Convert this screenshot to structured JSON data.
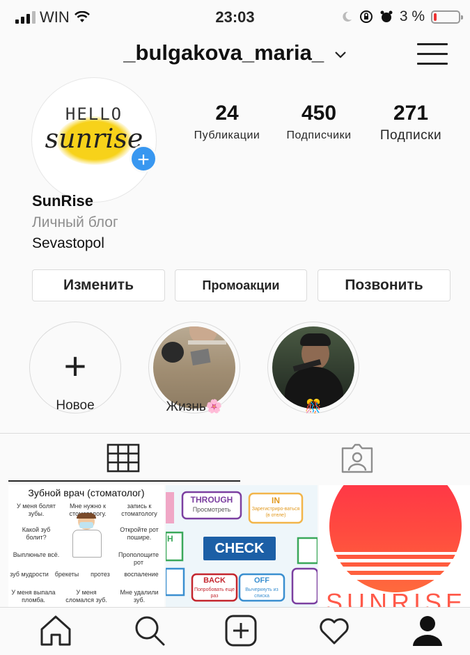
{
  "status_bar": {
    "carrier": "WIN",
    "time": "23:03",
    "battery": "3 %",
    "battery_level": 0.03
  },
  "header": {
    "username": "_bulgakova_maria_",
    "menu_icon": "hamburger-menu-icon"
  },
  "avatar": {
    "line1": "HELLO",
    "line2": "sunrise"
  },
  "stats": [
    {
      "value": "24",
      "label": "Публикации"
    },
    {
      "value": "450",
      "label": "Подписчики"
    },
    {
      "value": "271",
      "label": "Подписки"
    }
  ],
  "bio": {
    "name": "SunRise",
    "category": "Личный блог",
    "city": "Sevastopol"
  },
  "buttons": {
    "edit": "Изменить",
    "promotions": "Промоакции",
    "call": "Позвонить"
  },
  "highlights": [
    {
      "label": "Новое"
    },
    {
      "label": "Жизнь🌸"
    },
    {
      "label": "🎊"
    }
  ],
  "posts": {
    "dental": {
      "title": "Зубной врач (стоматолог)",
      "rows": [
        [
          "У меня болят зубы.",
          "Мне нужно к стоматологу.",
          "запись к стоматологу"
        ],
        [
          "Какой зуб болит?",
          "",
          "Откройте рот пошире."
        ],
        [
          "Выплюньте всё.",
          "",
          "Прополощите рот"
        ],
        [
          "зуб мудрости",
          "брекеты",
          "протез",
          "воспаление"
        ],
        [
          "У меня выпала пломба.",
          "У меня сломался зуб.",
          "Мне удалили зуб."
        ]
      ]
    },
    "check": {
      "center": "CHECK",
      "through": "THROUGH",
      "through_sub": "Просмотреть",
      "in": "IN",
      "in_sub": "Зарегистриро-ваться (в отеле)",
      "back": "BACK",
      "back_sub": "Попробовать еще раз",
      "off": "OFF",
      "off_sub": "Вычеркнуть из списка",
      "h": "H"
    },
    "sunrise": {
      "text": "SUNRISE"
    }
  },
  "colors": {
    "accent_blue": "#3897f0",
    "sun_top": "#ff2e4a",
    "sun_bottom": "#ff6a3d",
    "check_blue": "#1c5fa6"
  },
  "nav": [
    "home-icon",
    "search-icon",
    "new-post-icon",
    "activity-heart-icon",
    "profile-icon"
  ]
}
